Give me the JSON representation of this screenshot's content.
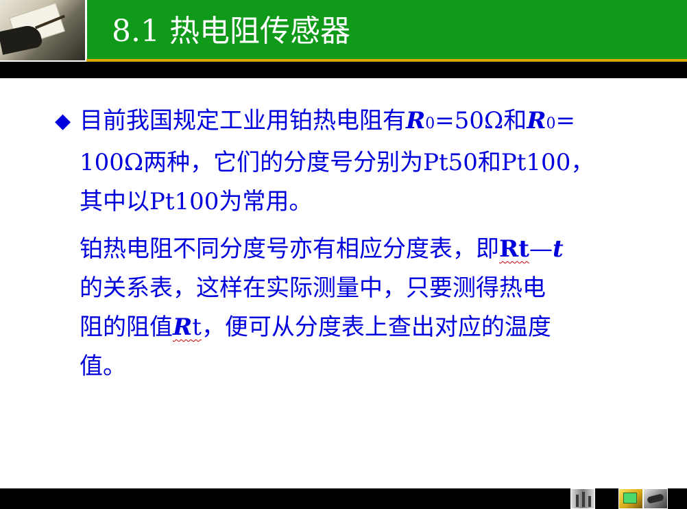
{
  "header": {
    "title": "8.1 热电阻传感器",
    "accent_color": "#0f9a1a",
    "line_color": "#d9a800"
  },
  "body": {
    "text_color": "#0000dd",
    "p1": {
      "bullet": "◆",
      "t1": "目前我国规定工业用铂热电阻有",
      "r_symbol_1": "R",
      "sub_1": "0",
      "t2": "=50Ω和",
      "r_symbol_2": "R",
      "sub_2": "0",
      "t3": "=",
      "t4": "100Ω两种，它们的分度号分别为Pt50和Pt100，",
      "t5": "其中以Pt100为常用。"
    },
    "p2": {
      "t1": "铂热电阻不同分度号亦有相应分度表，即",
      "rt": "Rt",
      "dash": "—",
      "t_var": "t",
      "t2": "的关系表，这样在实际测量中，只要测得热电",
      "t3": "阻的阻值",
      "rt2_r": "R",
      "rt2_t": "t",
      "t4": "，便可从分度表上查出对应的温度",
      "t5": "值。"
    }
  },
  "footer": {
    "icons": [
      "home-icon",
      "back-icon",
      "next-icon"
    ]
  }
}
